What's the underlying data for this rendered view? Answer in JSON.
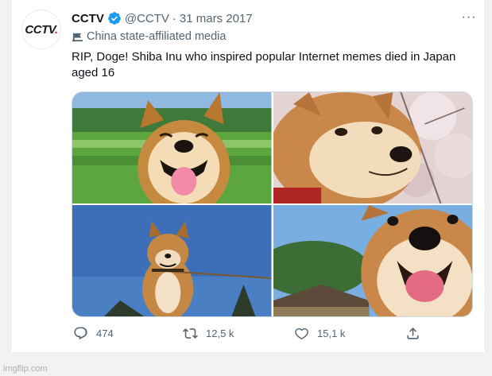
{
  "account": {
    "name": "CCTV",
    "handle": "@CCTV",
    "separator": "·",
    "date": "31 mars 2017",
    "logo_text": "CCTV",
    "logo_dot": "."
  },
  "affiliation": {
    "label": "China state-affiliated media",
    "icon": "flag-icon"
  },
  "tweet": {
    "text": "RIP, Doge! Shiba Inu who inspired popular Internet memes died in Japan aged 16"
  },
  "media": {
    "count": 4,
    "items": [
      {
        "icon": "photo",
        "subject": "shiba-smiling-field"
      },
      {
        "icon": "photo",
        "subject": "shiba-side-eye-blossoms"
      },
      {
        "icon": "photo",
        "subject": "shiba-blue-sky"
      },
      {
        "icon": "photo",
        "subject": "shiba-closeup-house"
      }
    ]
  },
  "actions": {
    "replies": "474",
    "retweets": "12,5 k",
    "likes": "15,1 k"
  },
  "more_label": "···",
  "watermark": "imgflip.com",
  "colors": {
    "accent": "#1d9bf0",
    "muted": "#536471",
    "text": "#0f1419",
    "border": "#cfd9de"
  }
}
